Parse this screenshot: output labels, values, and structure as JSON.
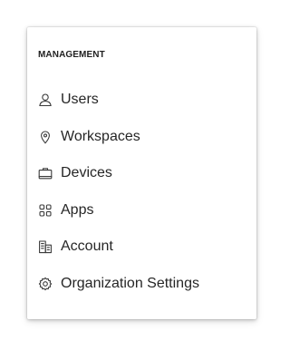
{
  "menu": {
    "section_title": "MANAGEMENT",
    "items": [
      {
        "label": "Users",
        "icon": "user-icon"
      },
      {
        "label": "Workspaces",
        "icon": "location-pin-icon"
      },
      {
        "label": "Devices",
        "icon": "device-icon"
      },
      {
        "label": "Apps",
        "icon": "apps-grid-icon"
      },
      {
        "label": "Account",
        "icon": "account-building-icon"
      },
      {
        "label": "Organization Settings",
        "icon": "gear-icon"
      }
    ]
  },
  "colors": {
    "text": "#262626",
    "icon": "#3a3a3a",
    "panel_background": "#ffffff"
  }
}
